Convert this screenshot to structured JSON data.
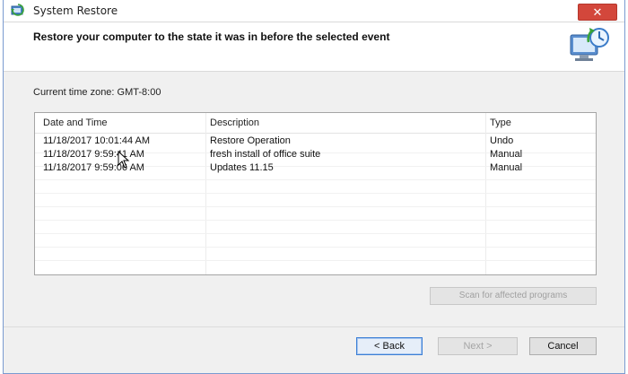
{
  "window": {
    "title": "System Restore",
    "close_glyph": "✕",
    "title_icon": "system-restore-icon"
  },
  "header": {
    "text": "Restore your computer to the state it was in before the selected event",
    "icon": "restore-computer-icon"
  },
  "timezone": {
    "label": "Current time zone: GMT-8:00"
  },
  "list": {
    "columns": [
      "Date and Time",
      "Description",
      "Type"
    ],
    "rows": [
      {
        "datetime": "11/18/2017 10:01:44 AM",
        "description": "Restore Operation",
        "type": "Undo"
      },
      {
        "datetime": "11/18/2017 9:59:41 AM",
        "description": "fresh install of office suite",
        "type": "Manual"
      },
      {
        "datetime": "11/18/2017 9:59:06 AM",
        "description": "Updates 11.15",
        "type": "Manual"
      }
    ]
  },
  "buttons": {
    "scan": "Scan for affected programs",
    "back": "< Back",
    "next": "Next >",
    "cancel": "Cancel"
  },
  "colors": {
    "close": "#d3473b",
    "focus_border": "#3c7fd6",
    "window_border": "#7a9bd0"
  }
}
